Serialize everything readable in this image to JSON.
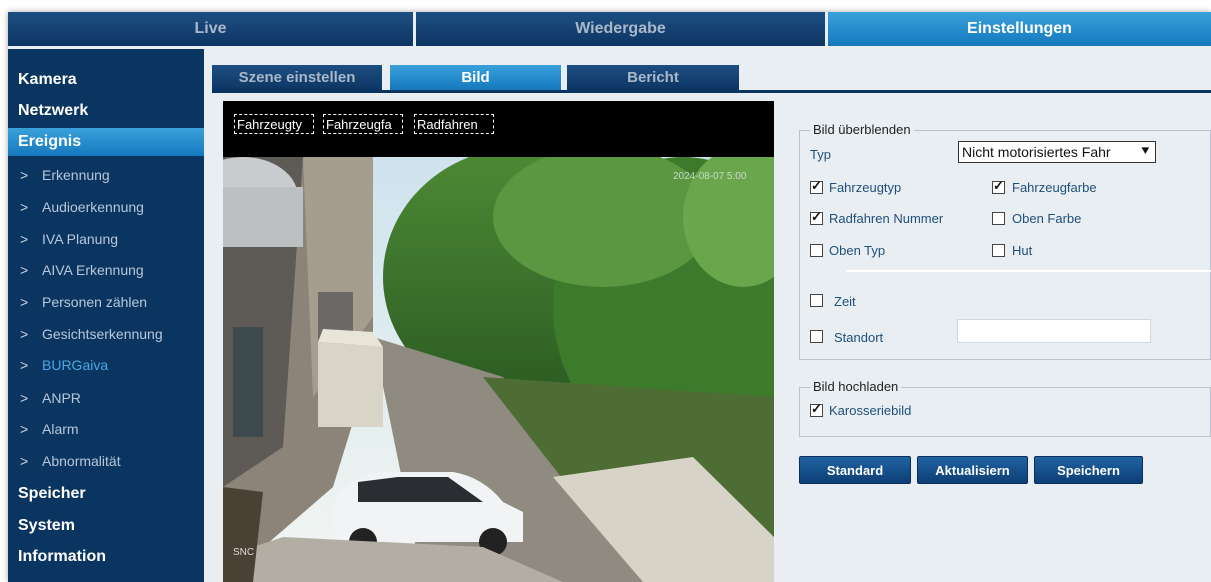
{
  "topnav": [
    {
      "label": "Live",
      "active": false
    },
    {
      "label": "Wiedergabe",
      "active": false
    },
    {
      "label": "Einstellungen",
      "active": true
    }
  ],
  "sidebar": {
    "main_items": [
      "Kamera",
      "Netzwerk",
      "Ereignis",
      "Speicher",
      "System",
      "Information"
    ],
    "active_main": "Ereignis",
    "sub_items": [
      "Erkennung",
      "Audioerkennung",
      "IVA Planung",
      "AIVA Erkennung",
      "Personen zählen",
      "Gesichtserkennung",
      "BURGaiva",
      "ANPR",
      "Alarm",
      "Abnormalität"
    ],
    "highlighted_sub": "BURGaiva"
  },
  "subtabs": [
    {
      "label": "Szene einstellen",
      "active": false
    },
    {
      "label": "Bild",
      "active": true
    },
    {
      "label": "Bericht",
      "active": false
    }
  ],
  "video": {
    "overlay_labels": [
      "Fahrzeugty",
      "Fahrzeugfa",
      "Radfahren"
    ],
    "timestamp": "2024-08-07 5:00",
    "watermark": "SNC"
  },
  "overlay_section": {
    "legend": "Bild überblenden",
    "type_label": "Typ",
    "type_value": "Nicht motorisiertes Fahr",
    "checkboxes": [
      {
        "label": "Fahrzeugtyp",
        "checked": true
      },
      {
        "label": "Fahrzeugfarbe",
        "checked": true
      },
      {
        "label": "Radfahren Nummer",
        "checked": true
      },
      {
        "label": "Oben Farbe",
        "checked": false
      },
      {
        "label": "Oben Typ",
        "checked": false
      },
      {
        "label": "Hut",
        "checked": false
      }
    ],
    "time_label": "Zeit",
    "time_checked": false,
    "location_label": "Standort",
    "location_checked": false,
    "location_value": ""
  },
  "upload_section": {
    "legend": "Bild hochladen",
    "body_image_label": "Karosseriebild",
    "body_image_checked": true
  },
  "buttons": {
    "standard": "Standard",
    "refresh": "Aktualisiern",
    "save": "Speichern"
  },
  "colors": {
    "nav_dark": "#0d3563",
    "nav_active": "#1578bd",
    "sidebar_bg": "#0b3561",
    "content_bg": "#e9eef3",
    "label_blue": "#1f4f7a"
  }
}
